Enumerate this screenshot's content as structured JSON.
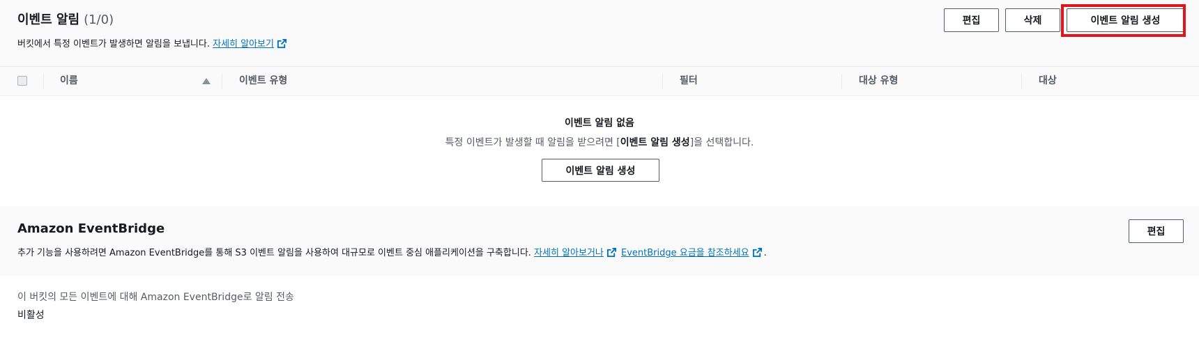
{
  "notifications": {
    "title": "이벤트 알림",
    "count": "(1/0)",
    "description": "버킷에서 특정 이벤트가 발생하면 알림을 보냅니다.",
    "learn_more": "자세히 알아보기",
    "buttons": {
      "edit": "편집",
      "delete": "삭제",
      "create": "이벤트 알림 생성"
    },
    "table": {
      "columns": [
        "이름",
        "이벤트 유형",
        "필터",
        "대상 유형",
        "대상"
      ]
    },
    "empty": {
      "title": "이벤트 알림 없음",
      "message_prefix": "특정 이벤트가 발생할 때 알림을 받으려면 [",
      "message_bold": "이벤트 알림 생성",
      "message_suffix": "]을 선택합니다.",
      "button": "이벤트 알림 생성"
    },
    "highlight_color": "#e0161c"
  },
  "eventbridge": {
    "title": "Amazon EventBridge",
    "description_prefix": "추가 기능을 사용하려면 Amazon EventBridge를 통해 S3 이벤트 알림을 사용하여 대규모로 이벤트 중심 애플리케이션을 구축합니다.",
    "link1": "자세히 알아보거나",
    "link2": "EventBridge 요금을 참조하세요",
    "description_suffix": ".",
    "edit_button": "편집",
    "setting_label": "이 버킷의 모든 이벤트에 대해 Amazon EventBridge로 알림 전송",
    "setting_value": "비활성"
  },
  "colors": {
    "link": "#0073bb",
    "text": "#16191f",
    "secondary_text": "#545b64"
  }
}
